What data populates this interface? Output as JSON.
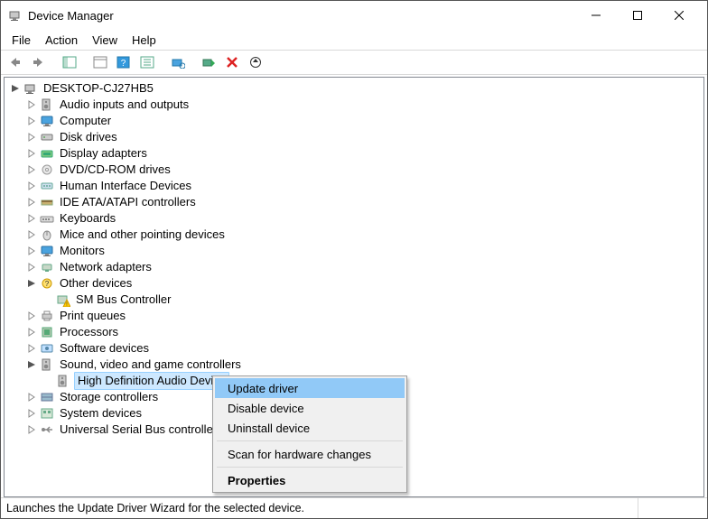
{
  "window": {
    "title": "Device Manager"
  },
  "menu": {
    "file": "File",
    "action": "Action",
    "view": "View",
    "help": "Help"
  },
  "root": {
    "label": "DESKTOP-CJ27HB5"
  },
  "categories": [
    {
      "label": "Audio inputs and outputs",
      "icon": "speaker"
    },
    {
      "label": "Computer",
      "icon": "monitor"
    },
    {
      "label": "Disk drives",
      "icon": "disk"
    },
    {
      "label": "Display adapters",
      "icon": "display"
    },
    {
      "label": "DVD/CD-ROM drives",
      "icon": "cdrom"
    },
    {
      "label": "Human Interface Devices",
      "icon": "hid"
    },
    {
      "label": "IDE ATA/ATAPI controllers",
      "icon": "ide"
    },
    {
      "label": "Keyboards",
      "icon": "keyboard"
    },
    {
      "label": "Mice and other pointing devices",
      "icon": "mouse"
    },
    {
      "label": "Monitors",
      "icon": "monitor"
    },
    {
      "label": "Network adapters",
      "icon": "network"
    }
  ],
  "other_devices": {
    "label": "Other devices",
    "child": {
      "label": "SM Bus Controller"
    }
  },
  "mid_categories": [
    {
      "label": "Print queues",
      "icon": "printer"
    },
    {
      "label": "Processors",
      "icon": "cpu"
    },
    {
      "label": "Software devices",
      "icon": "software"
    }
  ],
  "sound": {
    "label": "Sound, video and game controllers",
    "child": {
      "label": "High Definition Audio Device"
    }
  },
  "tail_categories": [
    {
      "label": "Storage controllers",
      "icon": "storage"
    },
    {
      "label": "System devices",
      "icon": "system"
    },
    {
      "label": "Universal Serial Bus controllers",
      "icon": "usb"
    }
  ],
  "context_menu": {
    "update": "Update driver",
    "disable": "Disable device",
    "uninstall": "Uninstall device",
    "scan": "Scan for hardware changes",
    "properties": "Properties"
  },
  "status": "Launches the Update Driver Wizard for the selected device."
}
